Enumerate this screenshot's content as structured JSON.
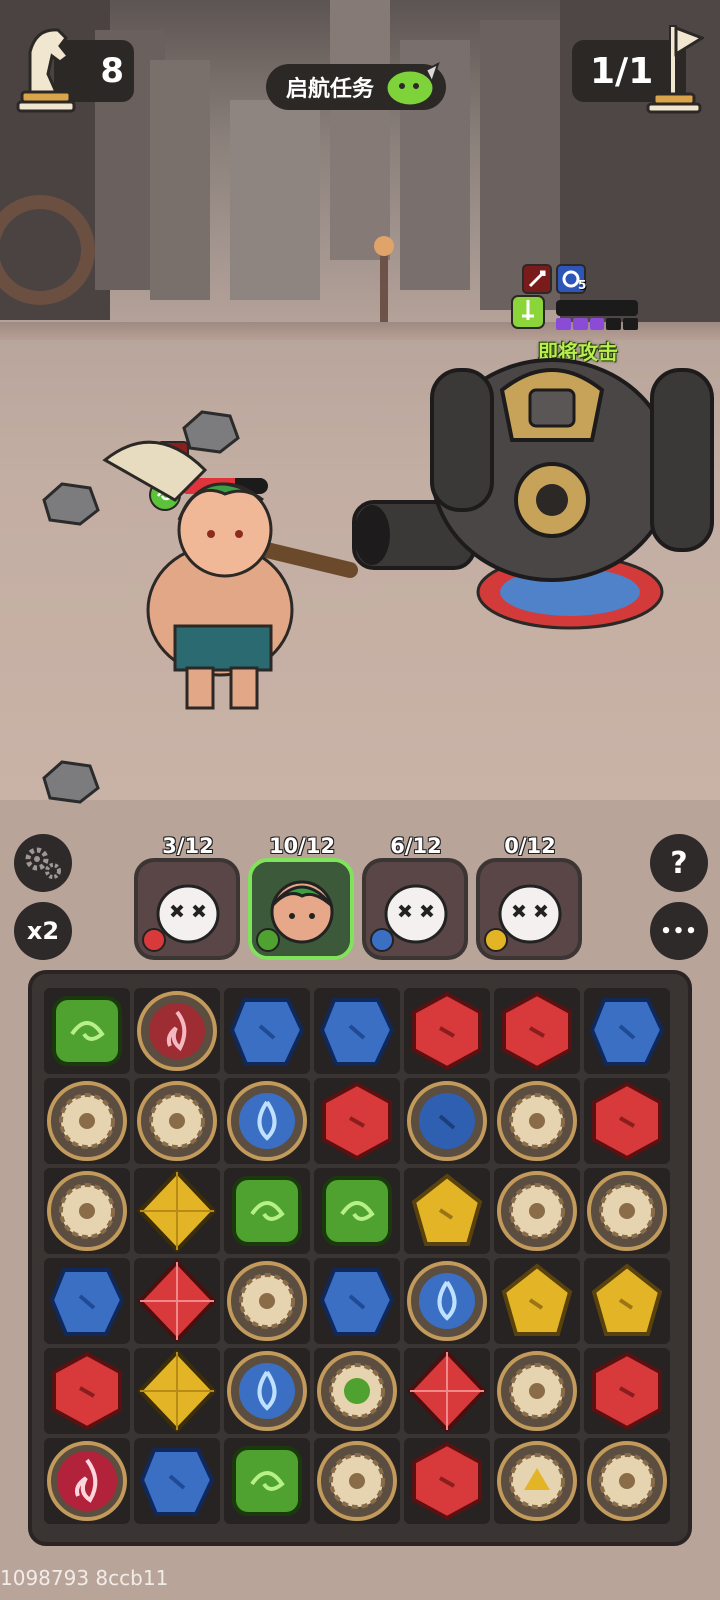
{
  "hud": {
    "knight_count": "8",
    "mission_title": "启航任务",
    "stage_progress": "1/1"
  },
  "enemy": {
    "status_text": "即将攻击",
    "shield_level": "5",
    "charge_pips_filled": 3,
    "charge_pips_total": 5
  },
  "hero": {
    "hp_fraction": 0.62
  },
  "controls": {
    "speed_label": "x2",
    "help_label": "?",
    "more_label": "•••"
  },
  "team": [
    {
      "count": "3/12",
      "element": "fire",
      "active": false
    },
    {
      "count": "10/12",
      "element": "nature",
      "active": true
    },
    {
      "count": "6/12",
      "element": "water",
      "active": false
    },
    {
      "count": "0/12",
      "element": "earth",
      "active": false
    }
  ],
  "board": {
    "rows": [
      [
        "green",
        "fire-rune",
        "blue",
        "blue",
        "red",
        "red",
        "blue"
      ],
      [
        "gear",
        "gear",
        "water-rune",
        "red",
        "blue-rune",
        "gear",
        "red"
      ],
      [
        "gear",
        "yellow-crystal",
        "green",
        "green",
        "yellow",
        "gear",
        "gear"
      ],
      [
        "blue",
        "red-crystal",
        "gear",
        "blue",
        "water-rune",
        "yellow",
        "yellow"
      ],
      [
        "red",
        "yellow-crystal",
        "water-rune",
        "nature-rune",
        "red-crystal",
        "gear",
        "red"
      ],
      [
        "fire-orb",
        "blue",
        "green",
        "gear",
        "red",
        "earth-rune",
        "gear"
      ]
    ]
  },
  "footer": {
    "build_id": "1098793 8ccb11"
  },
  "colors": {
    "red": "#d8393a",
    "blue": "#3a6fc4",
    "green": "#4fa22f",
    "yellow": "#e3b526",
    "active_border": "#7fe35c"
  }
}
